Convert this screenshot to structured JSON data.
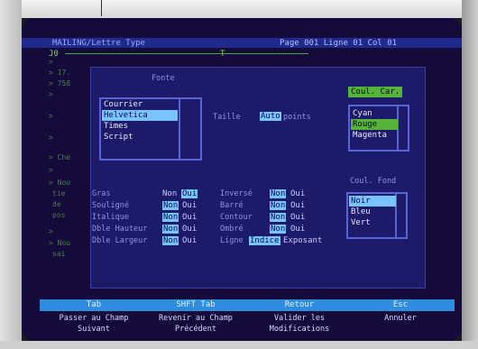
{
  "header": {
    "title": "MAILING/Lettre Type",
    "status": "Page 001 Ligne 01 Col 01"
  },
  "ruler": {
    "start": "J0",
    "mark": "T"
  },
  "background_lines": [
    ">",
    "> 17.",
    "> 758",
    ">",
    ">",
    ">",
    "> Che",
    ">",
    "> Nou",
    "tie",
    "de",
    "pos",
    ">",
    "> Nou",
    "sai"
  ],
  "fonte": {
    "title": "Fonte",
    "options": [
      "Courrier",
      "Helvetica",
      "Times",
      "Script"
    ],
    "selected_index": 1
  },
  "taille": {
    "label": "Taille",
    "value": "Auto",
    "unit": "points"
  },
  "coul_car": {
    "title": "Coul. Car.",
    "options": [
      "Cyan",
      "Rouge",
      "Magenta"
    ],
    "selected_index": 1
  },
  "coul_fond": {
    "title": "Coul. Fond",
    "options": [
      "Noir",
      "Bleu",
      "Vert"
    ],
    "selected_index": 0
  },
  "attributes_left": [
    {
      "label": "Gras",
      "non": "Non",
      "oui": "Oui",
      "selected": "oui"
    },
    {
      "label": "Souligné",
      "non": "Non",
      "oui": "Oui",
      "selected": "non"
    },
    {
      "label": "Italique",
      "non": "Non",
      "oui": "Oui",
      "selected": "non"
    },
    {
      "label": "Dble Hauteur",
      "non": "Non",
      "oui": "Oui",
      "selected": "non"
    },
    {
      "label": "Dble Largeur",
      "non": "Non",
      "oui": "Oui",
      "selected": "non"
    }
  ],
  "attributes_right": [
    {
      "label": "Inversé",
      "non": "Non",
      "oui": "Oui",
      "selected": "non"
    },
    {
      "label": "Barré",
      "non": "Non",
      "oui": "Oui",
      "selected": "non"
    },
    {
      "label": "Contour",
      "non": "Non",
      "oui": "Oui",
      "selected": "non"
    },
    {
      "label": "Ombré",
      "non": "Non",
      "oui": "Oui",
      "selected": "non"
    }
  ],
  "ligne": {
    "label": "Ligne",
    "indice": "Indice",
    "exposant": "Exposant",
    "selected": "indice"
  },
  "fkeys": [
    {
      "key": "Tab",
      "desc1": "Passer au Champ",
      "desc2": "Suivant"
    },
    {
      "key": "SHFT Tab",
      "desc1": "Revenir au Champ",
      "desc2": "Précédent"
    },
    {
      "key": "Retour",
      "desc1": "Valider les",
      "desc2": "Modifications"
    },
    {
      "key": "Esc",
      "desc1": "Annuler",
      "desc2": ""
    }
  ],
  "colors": {
    "screen": "#150b3a",
    "dialog": "#1e1a6a",
    "highlight": "#79c3ff",
    "green_highlight": "#56b33a",
    "fkey_bar": "#2f8de0"
  }
}
